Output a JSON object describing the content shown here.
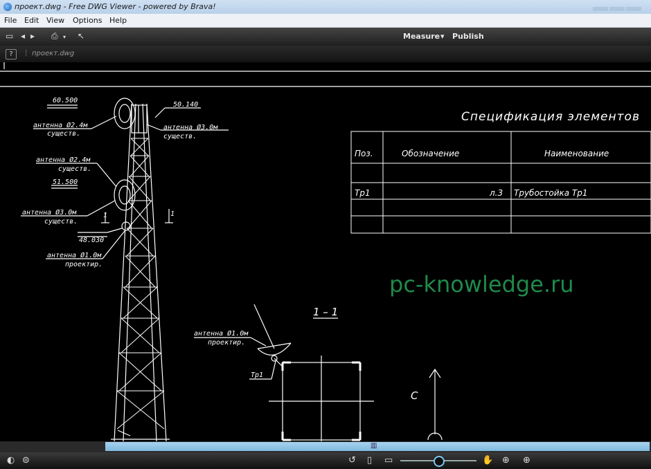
{
  "window": {
    "title": "проект.dwg - Free DWG Viewer - powered by Brava!"
  },
  "menu": [
    "File",
    "Edit",
    "View",
    "Options",
    "Help"
  ],
  "toolbar": {
    "measure_label": "Measure",
    "measure_arrow": "▾",
    "publish_label": "Publish"
  },
  "tab": {
    "help_label": "?",
    "document_name": "проект.dwg"
  },
  "drawing": {
    "spec_title": "Спецификация элементов",
    "table_headers": [
      "Поз.",
      "Обозначение",
      "Наименование"
    ],
    "table_rows": [
      [
        "Тр1",
        "л.3",
        "Трубостойка Тр1"
      ]
    ],
    "labels": {
      "level_top": "60.500",
      "level_right": "50.140",
      "level_mid": "51.500",
      "level_lower_top": "48.030",
      "antenna_24_existing_1": "антенна Ø2.4м",
      "existing_1": "существ.",
      "antenna_30_existing_top": "антенна Ø3.0м",
      "existing_top": "существ.",
      "antenna_24_existing_2": "антенна Ø2.4м",
      "existing_2": "существ.",
      "antenna_30_existing_low": "антенна Ø3.0м",
      "existing_low": "существ.",
      "antenna_10_projected": "антенна Ø1.0м",
      "projected": "проектир.",
      "antenna_10_section": "антенна Ø1.0м",
      "projected_section": "проектир.",
      "section_mark": "1 – 1",
      "tr1_label": "Тр1",
      "north_mark": "С",
      "cut_label_1": "1",
      "cut_label_2": "1"
    }
  },
  "watermark": "pc-knowledge.ru",
  "colors": {
    "canvas": "#000000",
    "lines": "#ffffff",
    "watermark": "#1f8a4a",
    "scroll_thumb": "#8cc4e6"
  }
}
